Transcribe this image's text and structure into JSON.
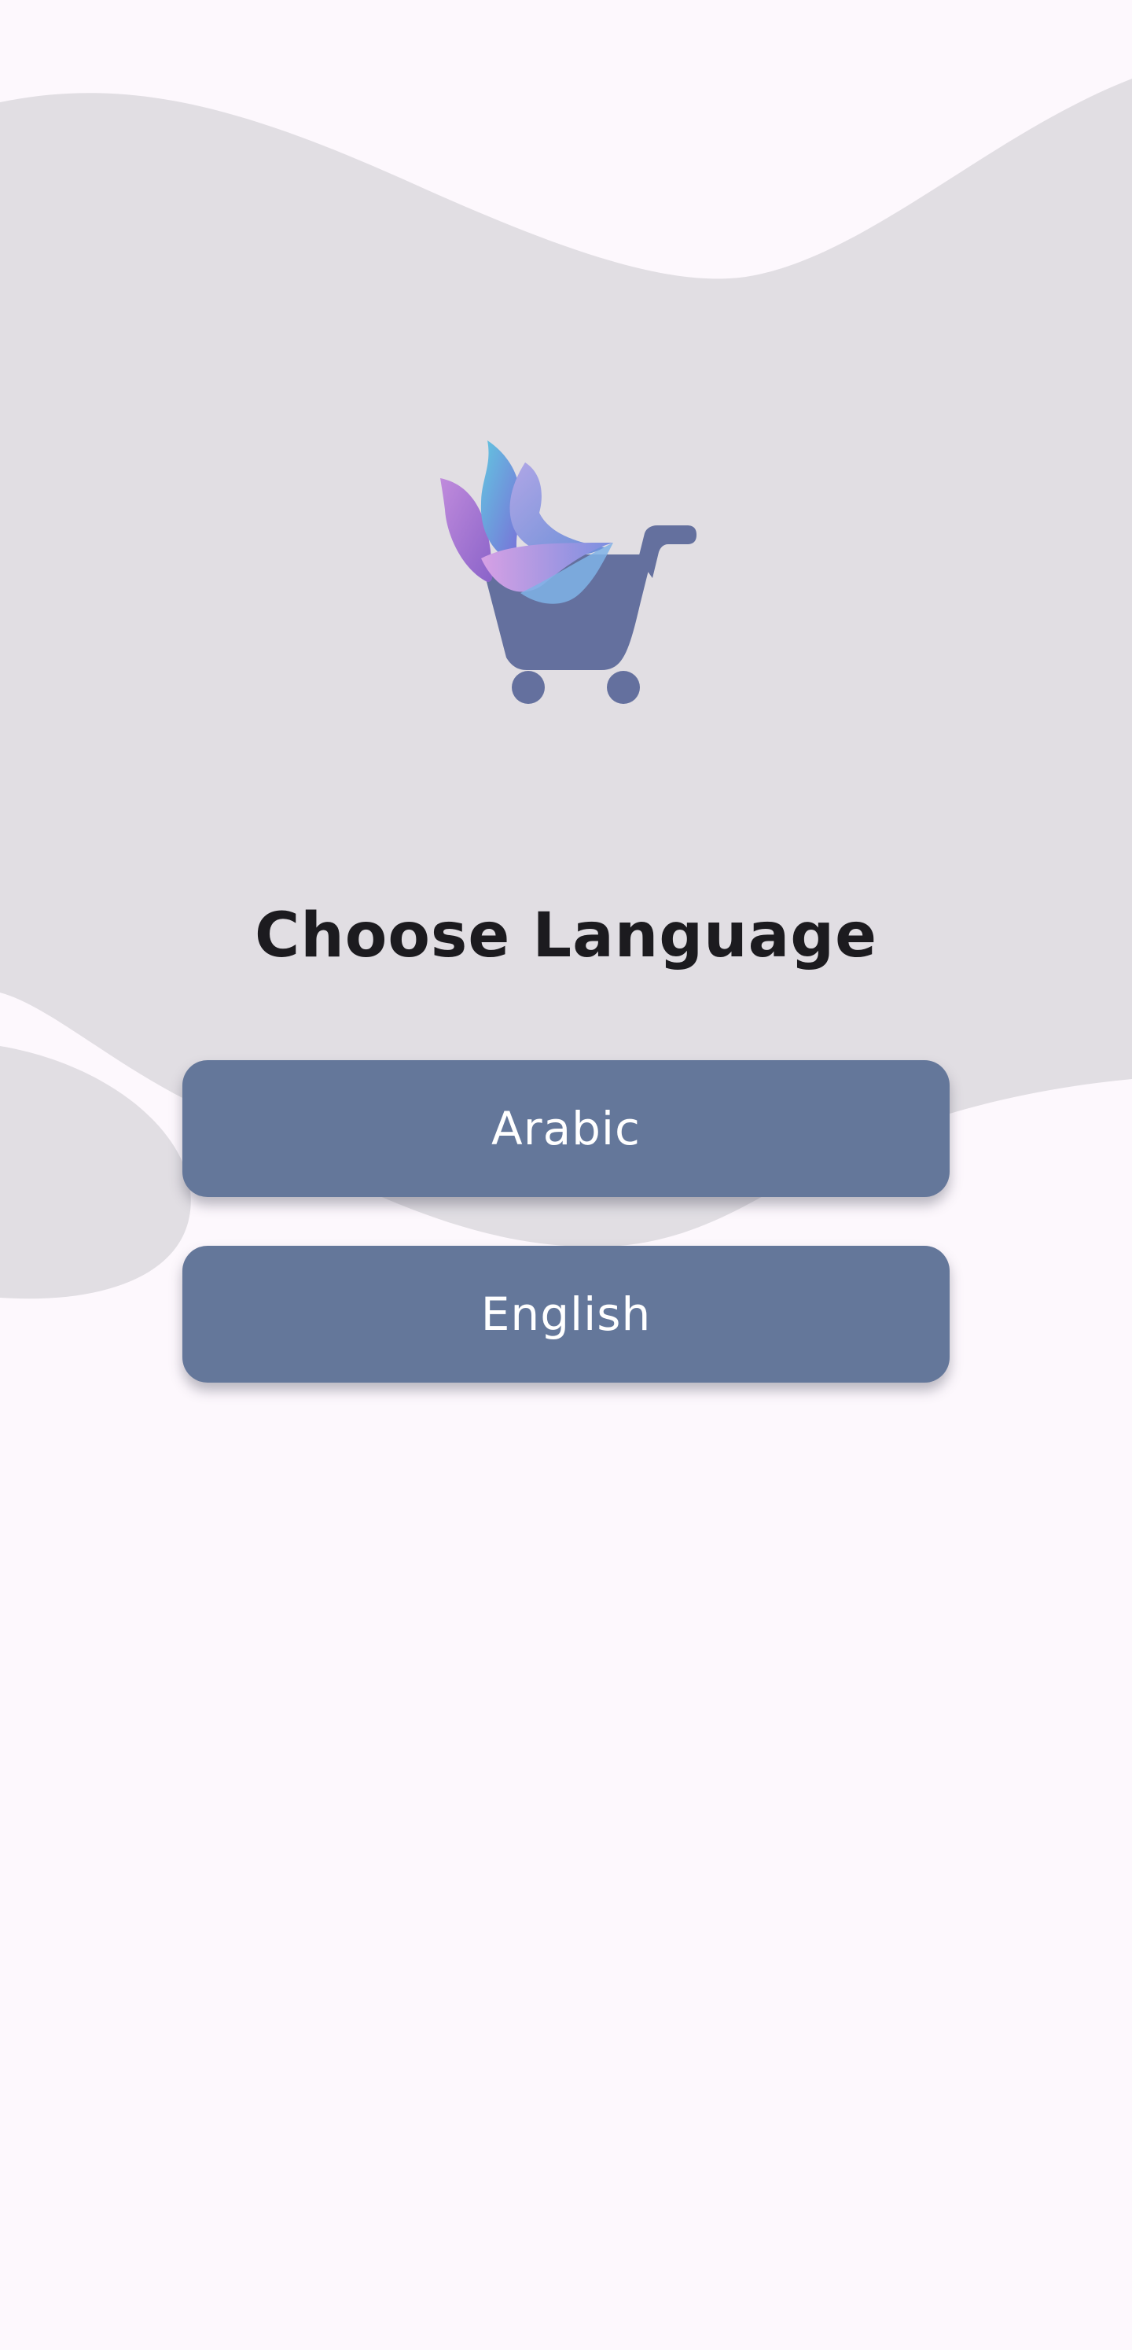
{
  "app": {
    "title": "Choose Language",
    "logo_icon": "shopping-cart-icon"
  },
  "buttons": {
    "arabic_label": "Arabic",
    "english_label": "English"
  },
  "colors": {
    "background": "#fdf8fd",
    "wave": "#e1dee3",
    "button": "#64779a",
    "button_text": "#ffffff",
    "title_text": "#1c1b1f"
  }
}
